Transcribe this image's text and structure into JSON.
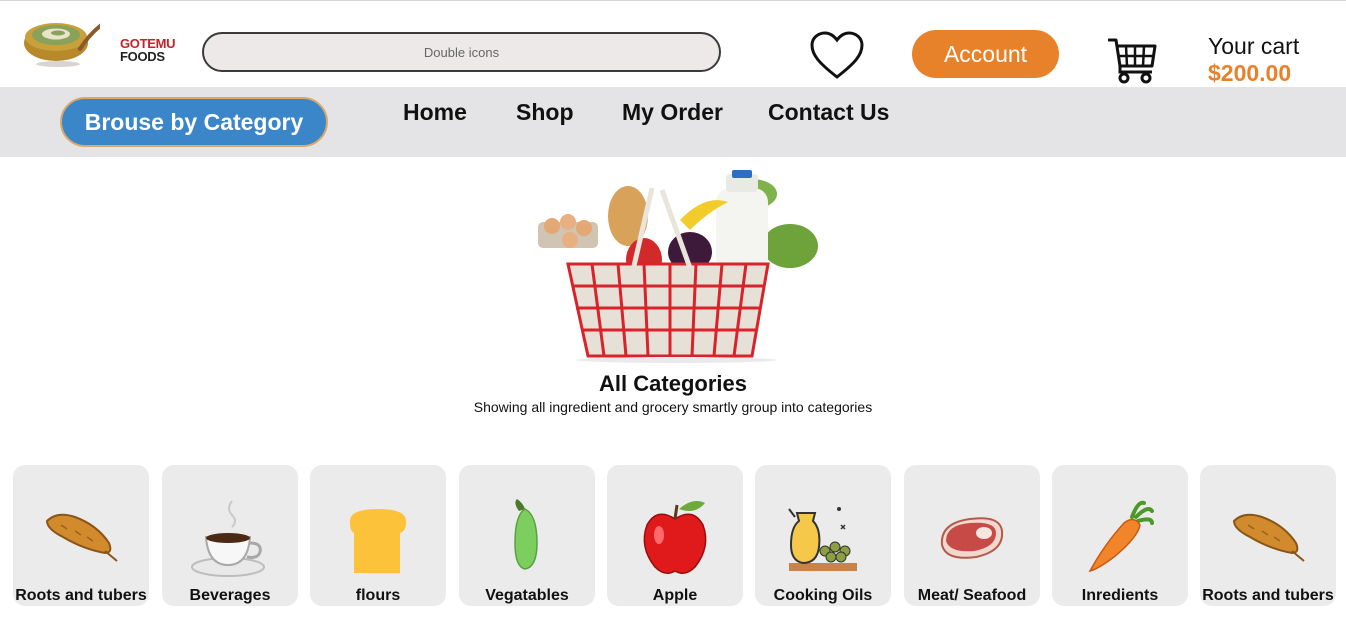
{
  "brand": {
    "name_line1": "GOTEMU",
    "name_line2": "FOODS",
    "brand_red": "#c8202a"
  },
  "header": {
    "search_placeholder": "Double icons",
    "account_label": "Account",
    "cart_label": "Your cart",
    "cart_amount": "$200.00",
    "accent": "#e8822a",
    "icons": [
      "heart-icon",
      "shopping-cart-icon"
    ]
  },
  "nav": {
    "browse_label": "Brouse by Category",
    "browse_color": "#3a86c8",
    "links": [
      "Home",
      "Shop",
      "My Order",
      "Contact Us"
    ]
  },
  "hero": {
    "title": "All Categories",
    "subtitle": "Showing all ingredient and grocery smartly group into categories"
  },
  "categories": [
    {
      "label": "Roots and tubers",
      "icon": "sweet-potato-icon"
    },
    {
      "label": "Beverages",
      "icon": "coffee-cup-icon"
    },
    {
      "label": "flours",
      "icon": "bread-icon"
    },
    {
      "label": "Vegatables",
      "icon": "green-vegetable-icon"
    },
    {
      "label": "Apple",
      "icon": "apple-icon"
    },
    {
      "label": "Cooking Oils",
      "icon": "oil-jar-icon"
    },
    {
      "label": "Meat/ Seafood",
      "icon": "steak-icon"
    },
    {
      "label": "Inredients",
      "icon": "carrot-icon"
    },
    {
      "label": "Roots and tubers",
      "icon": "sweet-potato-icon"
    }
  ]
}
